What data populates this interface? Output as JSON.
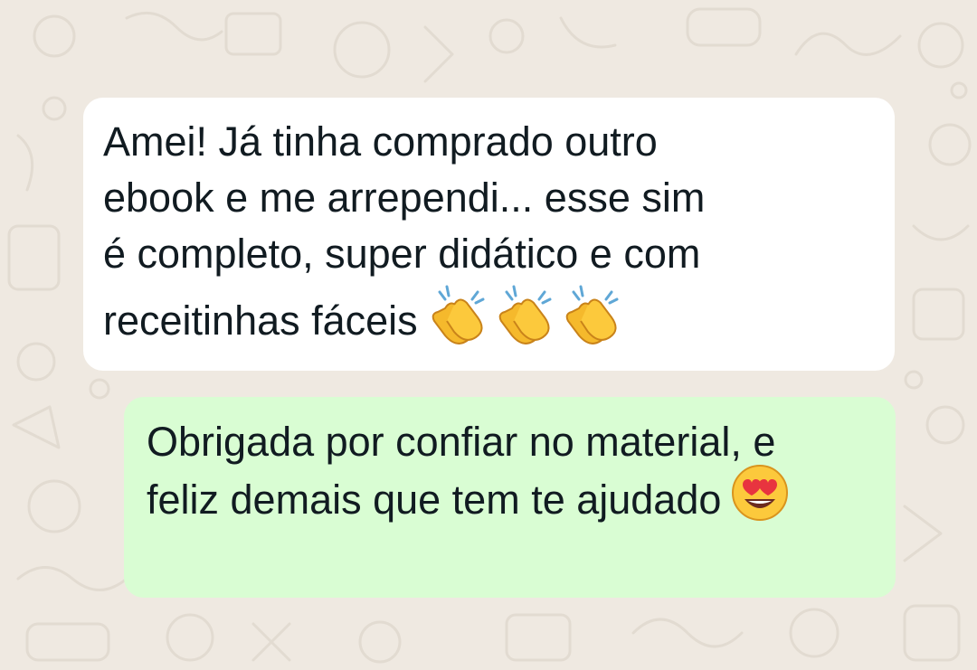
{
  "chat": {
    "incoming_message": {
      "lines": [
        "Amei! Já tinha comprado outro",
        "ebook e me arrependi... esse sim",
        "é completo, super didático e com",
        "receitinhas fáceis"
      ],
      "emojis": [
        "clapping-hands-icon",
        "clapping-hands-icon",
        "clapping-hands-icon"
      ]
    },
    "outgoing_message": {
      "lines": [
        "Obrigada por confiar no material, e",
        "feliz demais que tem te ajudado"
      ],
      "emojis": [
        "heart-eyes-face-icon"
      ]
    }
  },
  "colors": {
    "chat_background": "#efe9e1",
    "incoming_bubble": "#ffffff",
    "outgoing_bubble": "#d9fdd3",
    "text": "#111b21"
  }
}
